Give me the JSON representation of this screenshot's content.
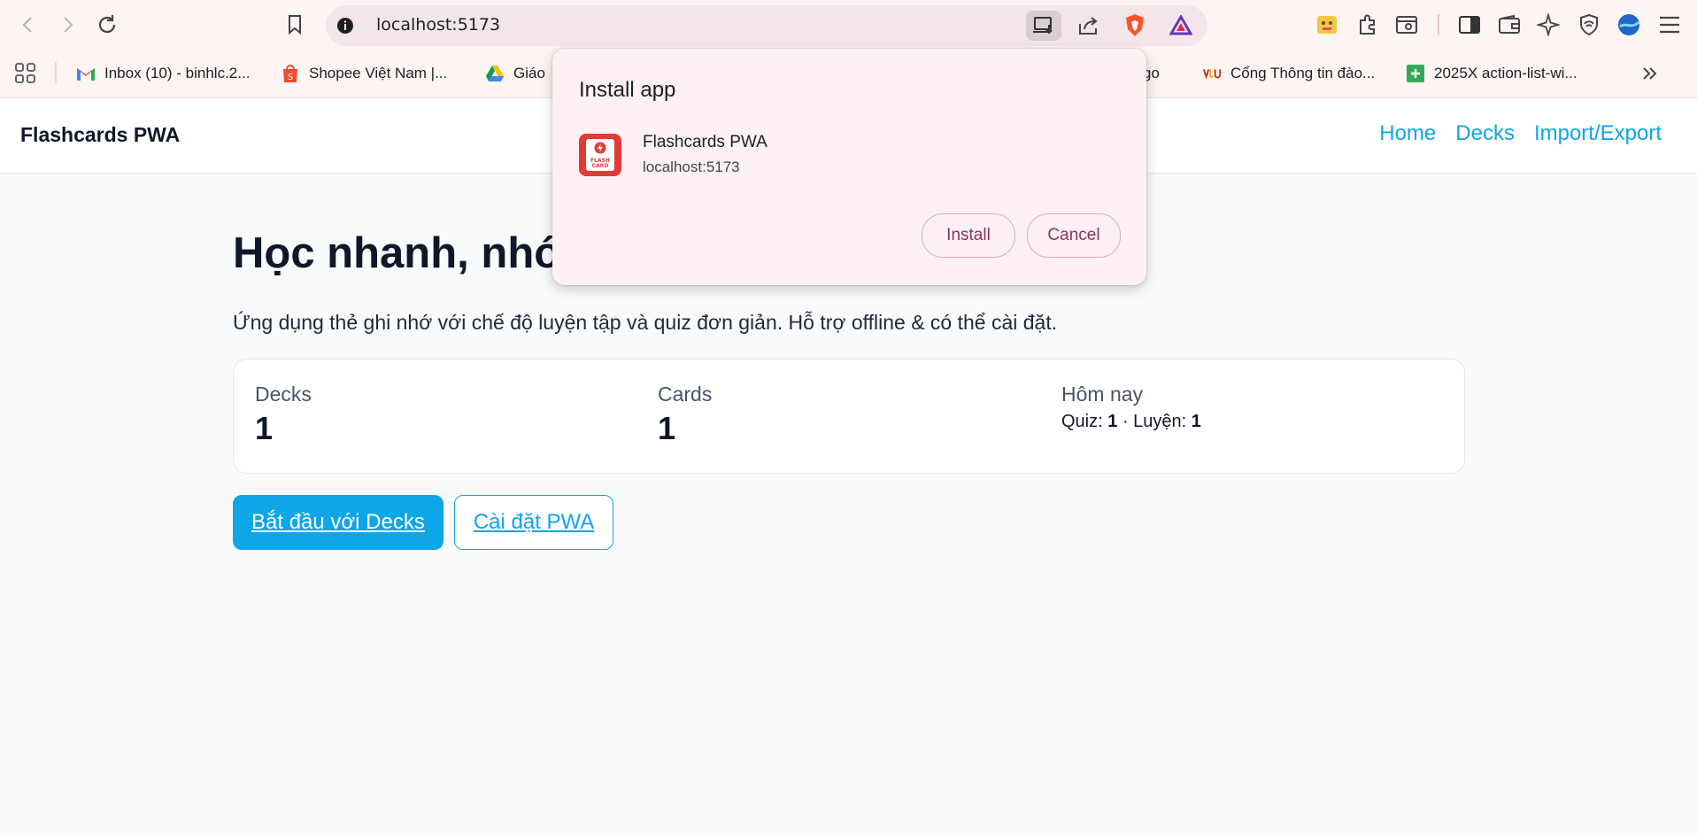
{
  "browser": {
    "url": "localhost:5173",
    "bookmarks": [
      {
        "label": "Inbox (10) - binhlc.2..."
      },
      {
        "label": "Shopee Việt Nam |..."
      },
      {
        "label": "Giáo"
      },
      {
        "label": "pago"
      },
      {
        "label": "Cổng Thông tin đào..."
      },
      {
        "label": "2025X action-list-wi..."
      }
    ]
  },
  "site": {
    "brand": "Flashcards PWA",
    "nav": [
      "Home",
      "Decks",
      "Import/Export"
    ]
  },
  "hero": {
    "title_visible": "Học nhanh, nhớ",
    "subtitle": "Ứng dụng thẻ ghi nhớ với chế độ luyện tập và quiz đơn giản. Hỗ trợ offline & có thể cài đặt."
  },
  "stats": {
    "decks_label": "Decks",
    "decks_value": "1",
    "cards_label": "Cards",
    "cards_value": "1",
    "today_label": "Hôm nay",
    "quiz_label": "Quiz:",
    "quiz_value": "1",
    "sep": "·",
    "practice_label": "Luyện:",
    "practice_value": "1"
  },
  "actions": {
    "primary": "Bắt đầu với Decks",
    "secondary": "Cài đặt PWA"
  },
  "install_dialog": {
    "title": "Install app",
    "app_name": "Flashcards PWA",
    "origin": "localhost:5173",
    "icon_text": [
      "FLASH",
      "CARD"
    ],
    "install": "Install",
    "cancel": "Cancel"
  },
  "colors": {
    "accent": "#0ea5e9",
    "app_icon": "#e53935",
    "dialog_button_text": "#8a3550"
  }
}
